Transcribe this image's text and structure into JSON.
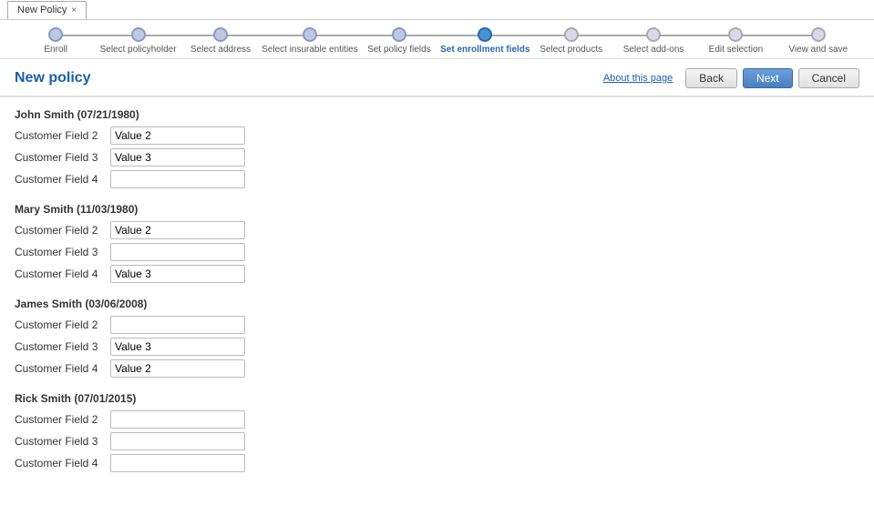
{
  "tab": {
    "label": "New Policy",
    "close": "×"
  },
  "wizard": {
    "steps": [
      {
        "id": "enroll",
        "label": "Enroll",
        "state": "completed"
      },
      {
        "id": "select-policyholder",
        "label": "Select policyholder",
        "state": "completed"
      },
      {
        "id": "select-address",
        "label": "Select address",
        "state": "completed"
      },
      {
        "id": "select-insurable",
        "label": "Select insurable entities",
        "state": "completed"
      },
      {
        "id": "set-policy-fields",
        "label": "Set policy fields",
        "state": "completed"
      },
      {
        "id": "set-enrollment-fields",
        "label": "Set enrollment fields",
        "state": "active"
      },
      {
        "id": "select-products",
        "label": "Select products",
        "state": "upcoming"
      },
      {
        "id": "select-addons",
        "label": "Select add-ons",
        "state": "upcoming"
      },
      {
        "id": "edit-selection",
        "label": "Edit selection",
        "state": "upcoming"
      },
      {
        "id": "view-and-save",
        "label": "View and save",
        "state": "upcoming"
      }
    ]
  },
  "header": {
    "page_title": "New policy",
    "about_link": "About this page",
    "back_label": "Back",
    "next_label": "Next",
    "cancel_label": "Cancel"
  },
  "persons": [
    {
      "name": "John Smith (07/21/1980)",
      "fields": [
        {
          "label": "Customer Field 2",
          "value": "Value 2"
        },
        {
          "label": "Customer Field 3",
          "value": "Value 3"
        },
        {
          "label": "Customer Field 4",
          "value": ""
        }
      ]
    },
    {
      "name": "Mary Smith (11/03/1980)",
      "fields": [
        {
          "label": "Customer Field 2",
          "value": "Value 2"
        },
        {
          "label": "Customer Field 3",
          "value": ""
        },
        {
          "label": "Customer Field 4",
          "value": "Value 3"
        }
      ]
    },
    {
      "name": "James Smith (03/06/2008)",
      "fields": [
        {
          "label": "Customer Field 2",
          "value": ""
        },
        {
          "label": "Customer Field 3",
          "value": "Value 3"
        },
        {
          "label": "Customer Field 4",
          "value": "Value 2"
        }
      ]
    },
    {
      "name": "Rick Smith (07/01/2015)",
      "fields": [
        {
          "label": "Customer Field 2",
          "value": ""
        },
        {
          "label": "Customer Field 3",
          "value": ""
        },
        {
          "label": "Customer Field 4",
          "value": ""
        }
      ]
    }
  ]
}
